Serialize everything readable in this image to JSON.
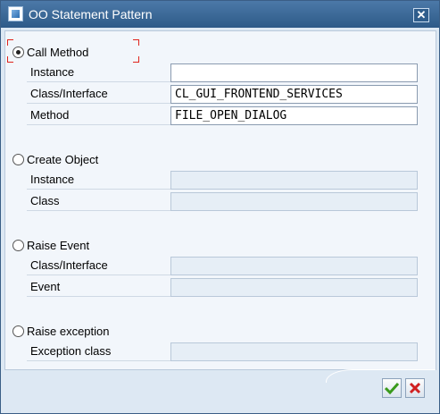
{
  "window": {
    "title": "OO Statement Pattern",
    "close_symbol": "✕"
  },
  "options": [
    {
      "label": "Call Method",
      "selected": true,
      "fields": [
        {
          "label": "Instance",
          "value": "",
          "enabled": true
        },
        {
          "label": "Class/Interface",
          "value": "CL_GUI_FRONTEND_SERVICES",
          "enabled": true
        },
        {
          "label": "Method",
          "value": "FILE_OPEN_DIALOG",
          "enabled": true
        }
      ]
    },
    {
      "label": "Create Object",
      "selected": false,
      "fields": [
        {
          "label": "Instance",
          "value": "",
          "enabled": false
        },
        {
          "label": "Class",
          "value": "",
          "enabled": false
        }
      ]
    },
    {
      "label": "Raise Event",
      "selected": false,
      "fields": [
        {
          "label": "Class/Interface",
          "value": "",
          "enabled": false
        },
        {
          "label": "Event",
          "value": "",
          "enabled": false
        }
      ]
    },
    {
      "label": "Raise exception",
      "selected": false,
      "fields": [
        {
          "label": "Exception class",
          "value": "",
          "enabled": false
        }
      ]
    }
  ],
  "buttons": {
    "ok_icon": "checkmark-icon",
    "cancel_icon": "cancel-x-icon",
    "ok_color": "#3a9a1c",
    "cancel_color": "#d02020"
  }
}
